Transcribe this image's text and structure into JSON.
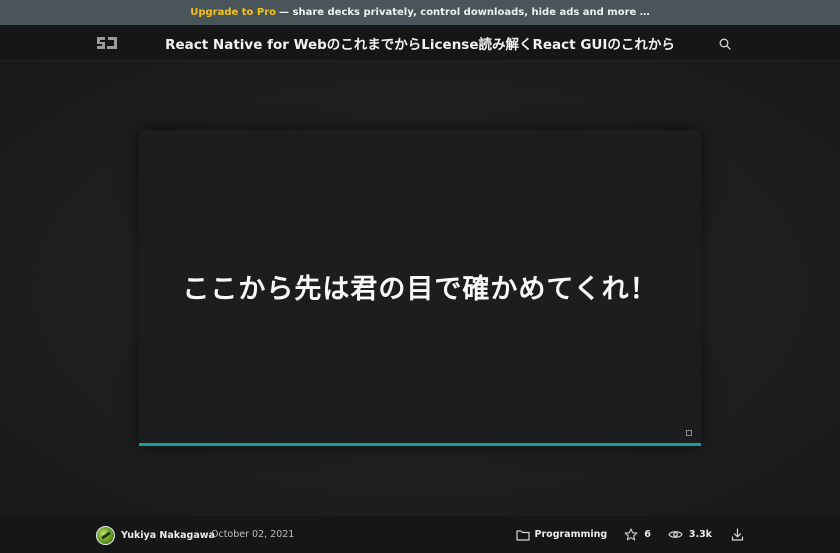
{
  "promo": {
    "link_label": "Upgrade to Pro",
    "text": "— share decks privately, control downloads, hide ads and more …",
    "accent_color": "#f4c21a"
  },
  "header": {
    "logo_icon": "speakerdeck-logo-icon",
    "title": "React Native for WebのこれまでからLicense読み解くReact GUIのこれから",
    "search_icon": "search-icon"
  },
  "slide": {
    "text": "ここから先は君の目で確かめてくれ！",
    "progress": 1.0,
    "progress_color": "#16a098"
  },
  "footer": {
    "author": "Yukiya Nakagawa",
    "date": "October 02, 2021",
    "category": "Programming",
    "stars": "6",
    "views": "3.3k",
    "icons": [
      "folder-icon",
      "star-icon",
      "eye-icon",
      "download-icon"
    ]
  }
}
